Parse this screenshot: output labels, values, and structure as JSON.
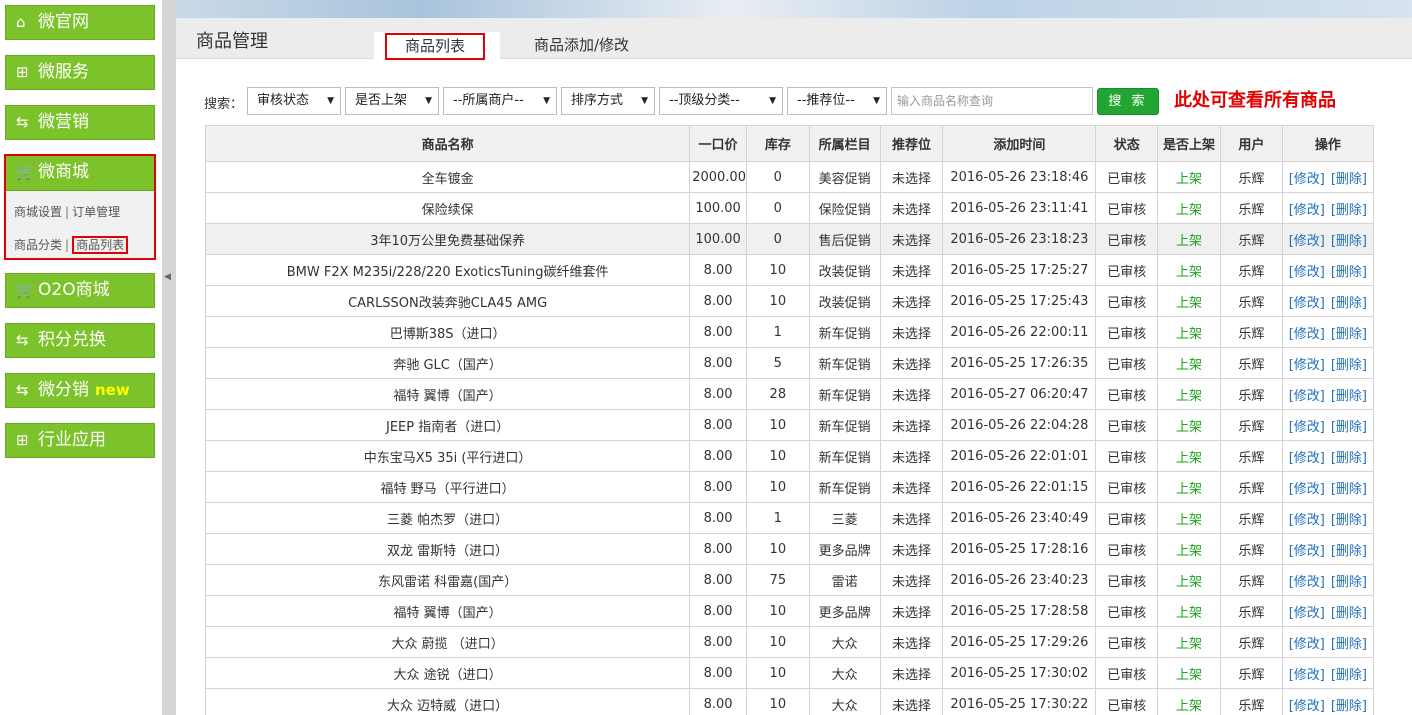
{
  "sidebar": {
    "items": [
      {
        "label": "微官网",
        "icon": "home-icon"
      },
      {
        "label": "微服务",
        "icon": "grid-icon"
      },
      {
        "label": "微营销",
        "icon": "exchange-icon"
      },
      {
        "label": "微商城",
        "icon": "cart-icon"
      },
      {
        "label": "O2O商城",
        "icon": "cart-icon"
      },
      {
        "label": "积分兑换",
        "icon": "exchange-icon"
      },
      {
        "label": "微分销",
        "icon": "exchange-icon",
        "badge": "new"
      },
      {
        "label": "行业应用",
        "icon": "grid-icon"
      }
    ],
    "mall_submenu": {
      "row1": [
        "商城设置",
        "订单管理"
      ],
      "row2": [
        "商品分类",
        "商品列表"
      ]
    }
  },
  "header": {
    "title": "商品管理",
    "tabs": [
      {
        "label": "商品列表",
        "active": true
      },
      {
        "label": "商品添加/修改",
        "active": false
      }
    ]
  },
  "search": {
    "label": "搜索：",
    "filters": [
      "审核状态",
      "是否上架",
      "--所属商户--",
      "排序方式",
      "--顶级分类--",
      "--推荐位--"
    ],
    "placeholder": "输入商品名称查询",
    "button_label": "搜 索",
    "note": "此处可查看所有商品"
  },
  "table": {
    "headers": [
      "商品名称",
      "一口价",
      "库存",
      "所属栏目",
      "推荐位",
      "添加时间",
      "状态",
      "是否上架",
      "用户",
      "操作"
    ],
    "edit_label": "[修改]",
    "delete_label": "[删除]",
    "rows": [
      [
        "全车镀金",
        "2000.00",
        "0",
        "美容促销",
        "未选择",
        "2016-05-26 23:18:46",
        "已审核",
        "上架",
        "乐辉"
      ],
      [
        "保险续保",
        "100.00",
        "0",
        "保险促销",
        "未选择",
        "2016-05-26 23:11:41",
        "已审核",
        "上架",
        "乐辉"
      ],
      [
        "3年10万公里免费基础保养",
        "100.00",
        "0",
        "售后促销",
        "未选择",
        "2016-05-26 23:18:23",
        "已审核",
        "上架",
        "乐辉"
      ],
      [
        "BMW F2X M235i/228/220 ExoticsTuning碳纤维套件",
        "8.00",
        "10",
        "改装促销",
        "未选择",
        "2016-05-25 17:25:27",
        "已审核",
        "上架",
        "乐辉"
      ],
      [
        "CARLSSON改装奔驰CLA45 AMG",
        "8.00",
        "10",
        "改装促销",
        "未选择",
        "2016-05-25 17:25:43",
        "已审核",
        "上架",
        "乐辉"
      ],
      [
        "巴博斯38S（进口）",
        "8.00",
        "1",
        "新车促销",
        "未选择",
        "2016-05-26 22:00:11",
        "已审核",
        "上架",
        "乐辉"
      ],
      [
        "奔驰 GLC（国产）",
        "8.00",
        "5",
        "新车促销",
        "未选择",
        "2016-05-25 17:26:35",
        "已审核",
        "上架",
        "乐辉"
      ],
      [
        "福特 翼博（国产）",
        "8.00",
        "28",
        "新车促销",
        "未选择",
        "2016-05-27 06:20:47",
        "已审核",
        "上架",
        "乐辉"
      ],
      [
        "JEEP 指南者（进口）",
        "8.00",
        "10",
        "新车促销",
        "未选择",
        "2016-05-26 22:04:28",
        "已审核",
        "上架",
        "乐辉"
      ],
      [
        "中东宝马X5 35i (平行进口）",
        "8.00",
        "10",
        "新车促销",
        "未选择",
        "2016-05-26 22:01:01",
        "已审核",
        "上架",
        "乐辉"
      ],
      [
        "福特 野马（平行进口）",
        "8.00",
        "10",
        "新车促销",
        "未选择",
        "2016-05-26 22:01:15",
        "已审核",
        "上架",
        "乐辉"
      ],
      [
        "三菱 帕杰罗（进口）",
        "8.00",
        "1",
        "三菱",
        "未选择",
        "2016-05-26 23:40:49",
        "已审核",
        "上架",
        "乐辉"
      ],
      [
        "双龙 雷斯特（进口）",
        "8.00",
        "10",
        "更多品牌",
        "未选择",
        "2016-05-25 17:28:16",
        "已审核",
        "上架",
        "乐辉"
      ],
      [
        "东风雷诺 科雷嘉(国产）",
        "8.00",
        "75",
        "雷诺",
        "未选择",
        "2016-05-26 23:40:23",
        "已审核",
        "上架",
        "乐辉"
      ],
      [
        "福特 翼博（国产）",
        "8.00",
        "10",
        "更多品牌",
        "未选择",
        "2016-05-25 17:28:58",
        "已审核",
        "上架",
        "乐辉"
      ],
      [
        "大众 蔚揽 （进口）",
        "8.00",
        "10",
        "大众",
        "未选择",
        "2016-05-25 17:29:26",
        "已审核",
        "上架",
        "乐辉"
      ],
      [
        "大众 途锐（进口）",
        "8.00",
        "10",
        "大众",
        "未选择",
        "2016-05-25 17:30:02",
        "已审核",
        "上架",
        "乐辉"
      ],
      [
        "大众 迈特威（进口）",
        "8.00",
        "10",
        "大众",
        "未选择",
        "2016-05-25 17:30:22",
        "已审核",
        "上架",
        "乐辉"
      ]
    ]
  }
}
